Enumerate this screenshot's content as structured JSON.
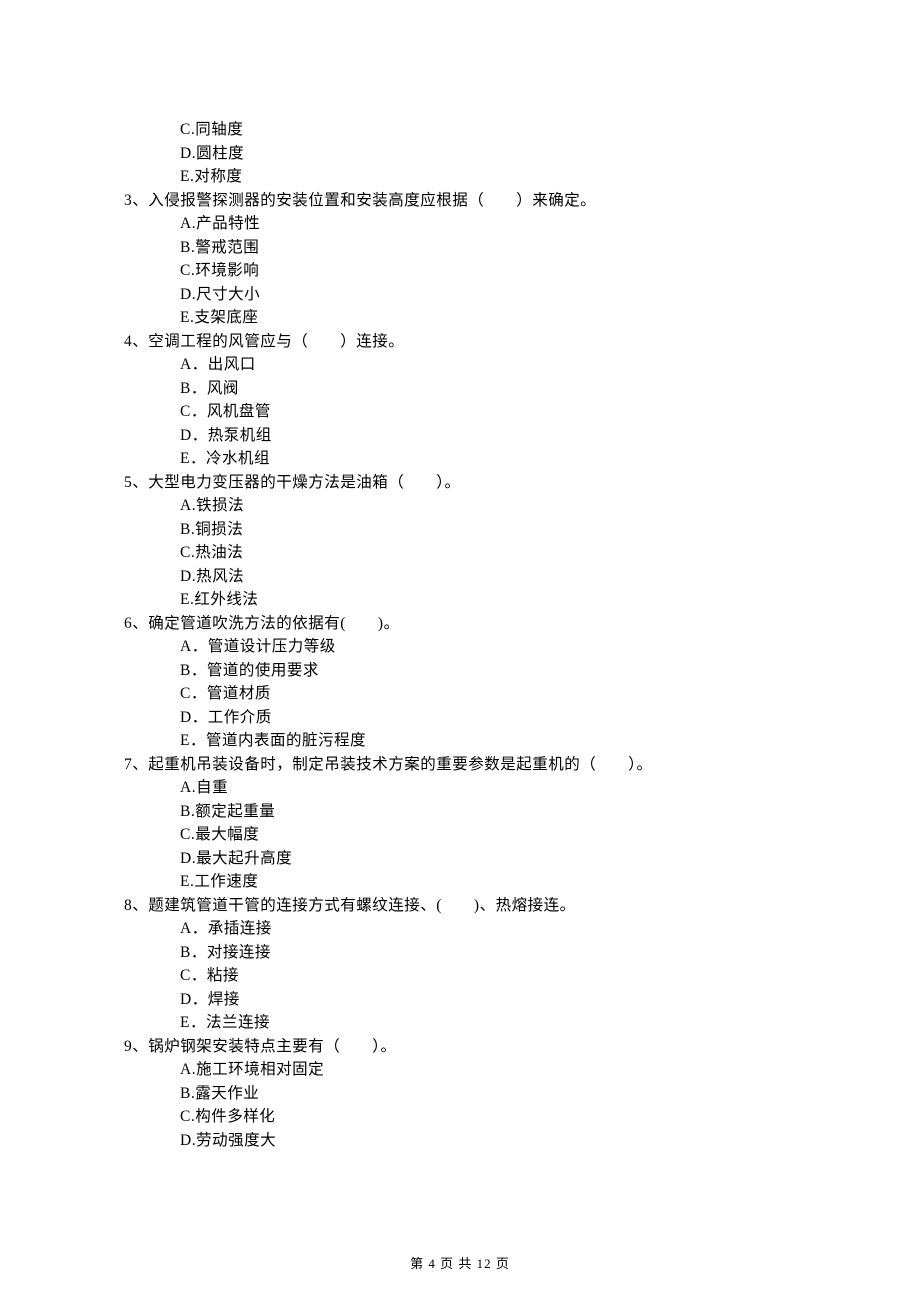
{
  "partial_options_top": [
    "C.同轴度",
    "D.圆柱度",
    "E.对称度"
  ],
  "questions": [
    {
      "number": "3、",
      "stem": "入侵报警探测器的安装位置和安装高度应根据（　　）来确定。",
      "options": [
        "A.产品特性",
        "B.警戒范围",
        "C.环境影响",
        "D.尺寸大小",
        "E.支架底座"
      ]
    },
    {
      "number": "4、",
      "stem": "空调工程的风管应与（　　）连接。",
      "options": [
        "A．出风口",
        "B．风阀",
        "C．风机盘管",
        "D．热泵机组",
        "E．冷水机组"
      ]
    },
    {
      "number": "5、",
      "stem": "大型电力变压器的干燥方法是油箱（　　）。",
      "options": [
        "A.铁损法",
        "B.铜损法",
        "C.热油法",
        "D.热风法",
        "E.红外线法"
      ]
    },
    {
      "number": "6、",
      "stem": "确定管道吹洗方法的依据有(　　)。",
      "options": [
        "A．管道设计压力等级",
        "B．管道的使用要求",
        "C．管道材质",
        "D．工作介质",
        "E．管道内表面的脏污程度"
      ]
    },
    {
      "number": "7、",
      "stem": "起重机吊装设备时，制定吊装技术方案的重要参数是起重机的（　　）。",
      "options": [
        "A.自重",
        "B.额定起重量",
        "C.最大幅度",
        "D.最大起升高度",
        "E.工作速度"
      ]
    },
    {
      "number": "8、",
      "stem": "题建筑管道干管的连接方式有螺纹连接、(　　)、热熔接连。",
      "options": [
        "A．承插连接",
        "B．对接连接",
        "C．粘接",
        "D．焊接",
        "E．法兰连接"
      ]
    },
    {
      "number": "9、",
      "stem": "锅炉钢架安装特点主要有（　　）。",
      "options": [
        "A.施工环境相对固定",
        "B.露天作业",
        "C.构件多样化",
        "D.劳动强度大"
      ]
    }
  ],
  "footer": "第 4 页 共 12 页"
}
